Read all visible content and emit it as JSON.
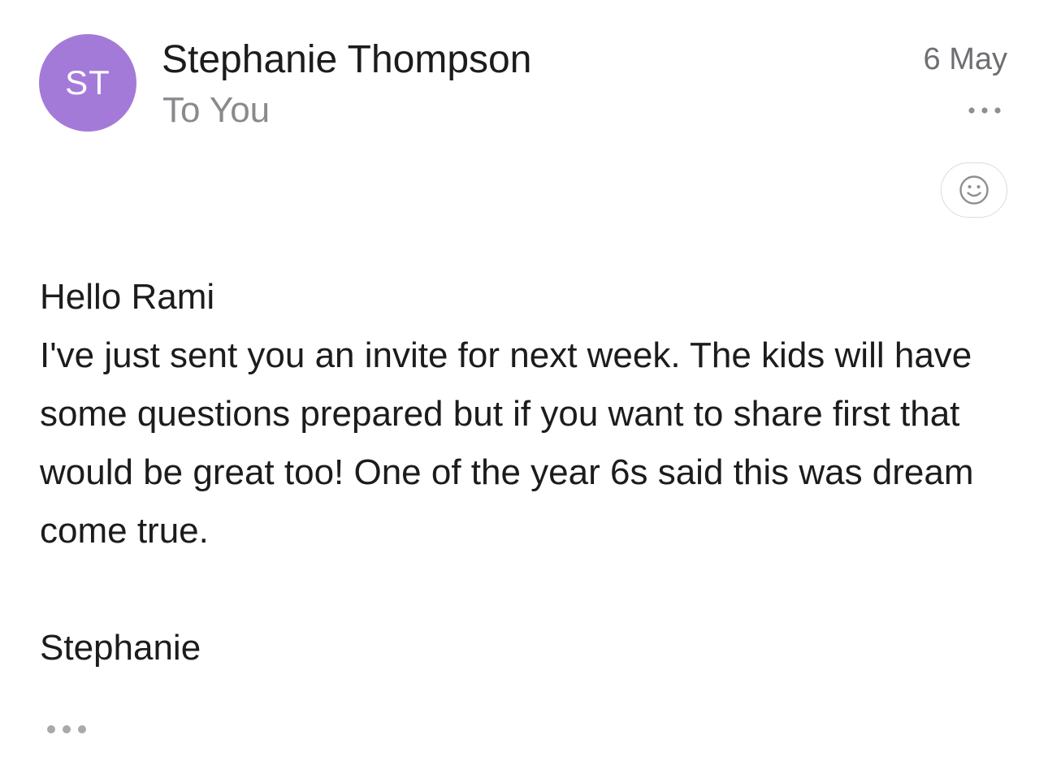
{
  "message": {
    "avatar": {
      "initials": "ST",
      "color": "#a47ad9"
    },
    "sender_name": "Stephanie Thompson",
    "recipient": "To You",
    "date": "6 May",
    "greeting": "Hello Rami",
    "body": "I've just sent you an invite for next week. The kids will have some questions prepared but if you want to share first that would be great too! One of the year 6s said this was dream come true.",
    "signature": "Stephanie"
  },
  "icons": {
    "more": "more-horizontal-icon",
    "emoji": "smiley-face-icon",
    "expand": "ellipsis-icon"
  },
  "colors": {
    "icon_gray": "#8e8e93",
    "light_gray": "#a8a8ad"
  }
}
